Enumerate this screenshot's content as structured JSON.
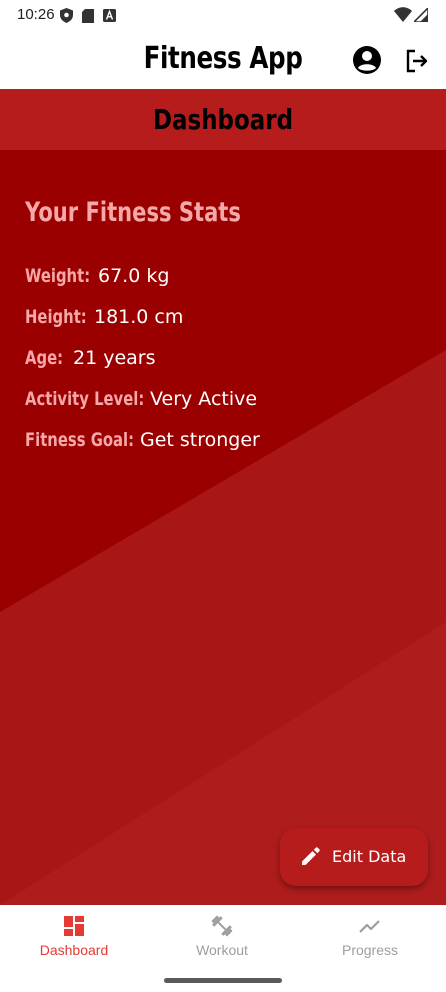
{
  "status_bar": {
    "time": "10:26",
    "icons_left": [
      "shield-icon",
      "sd-card-icon",
      "font-a-icon"
    ],
    "icons_right": [
      "wifi-icon",
      "cell-signal-icon"
    ]
  },
  "app_bar": {
    "title": "Fitness App",
    "icons": [
      "account-circle-icon",
      "logout-icon"
    ]
  },
  "dashboard_header": {
    "title": "Dashboard"
  },
  "stats": {
    "title": "Your Fitness Stats",
    "rows": [
      {
        "label": "Weight:",
        "value": "67.0 kg"
      },
      {
        "label": "Height:",
        "value": "181.0 cm"
      },
      {
        "label": "Age:",
        "value": "21 years"
      },
      {
        "label": "Activity Level:",
        "value": "Very Active"
      },
      {
        "label": "Fitness Goal:",
        "value": "Get stronger"
      }
    ]
  },
  "fab": {
    "label": "Edit Data",
    "icon": "pencil-icon"
  },
  "bottom_nav": {
    "items": [
      {
        "label": "Dashboard",
        "icon": "dashboard-icon",
        "active": true
      },
      {
        "label": "Workout",
        "icon": "dumbbell-icon",
        "active": false
      },
      {
        "label": "Progress",
        "icon": "trending-up-icon",
        "active": false
      }
    ]
  },
  "colors": {
    "primary": "#b71c1c",
    "background": "#9c0000",
    "stat_label": "#f6a7a7",
    "stat_value": "#ffffff",
    "nav_active": "#e53935",
    "nav_inactive": "#9e9e9e"
  }
}
